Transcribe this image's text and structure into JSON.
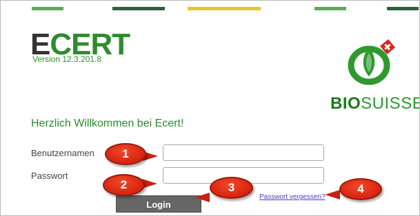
{
  "header": {
    "stripes": [
      {
        "color": "#5bab5b"
      },
      {
        "color": "#2f5f3a"
      },
      {
        "color": "#e8c629"
      },
      {
        "color": "#5bab5b"
      },
      {
        "color": "#2f5f3a"
      }
    ]
  },
  "ecert": {
    "logo_first": "E",
    "logo_rest": "CERT",
    "version": "Version 12.3.201.8"
  },
  "biosuisse": {
    "bio": "BIO",
    "suisse": "SUISSE"
  },
  "welcome": "Herzlich Willkommen bei Ecert!",
  "form": {
    "username_label": "Benutzernamen",
    "username_value": "",
    "password_label": "Passwort",
    "password_value": "",
    "login_label": "Login",
    "forgot_label": "Passwort vergessen?"
  },
  "annotations": {
    "one": "1",
    "two": "2",
    "three": "3",
    "four": "4"
  },
  "colors": {
    "brand_green": "#2e8b2e",
    "badge_red": "#dd2a15",
    "button_gray": "#666666",
    "link_purple": "#4b3bbf"
  }
}
